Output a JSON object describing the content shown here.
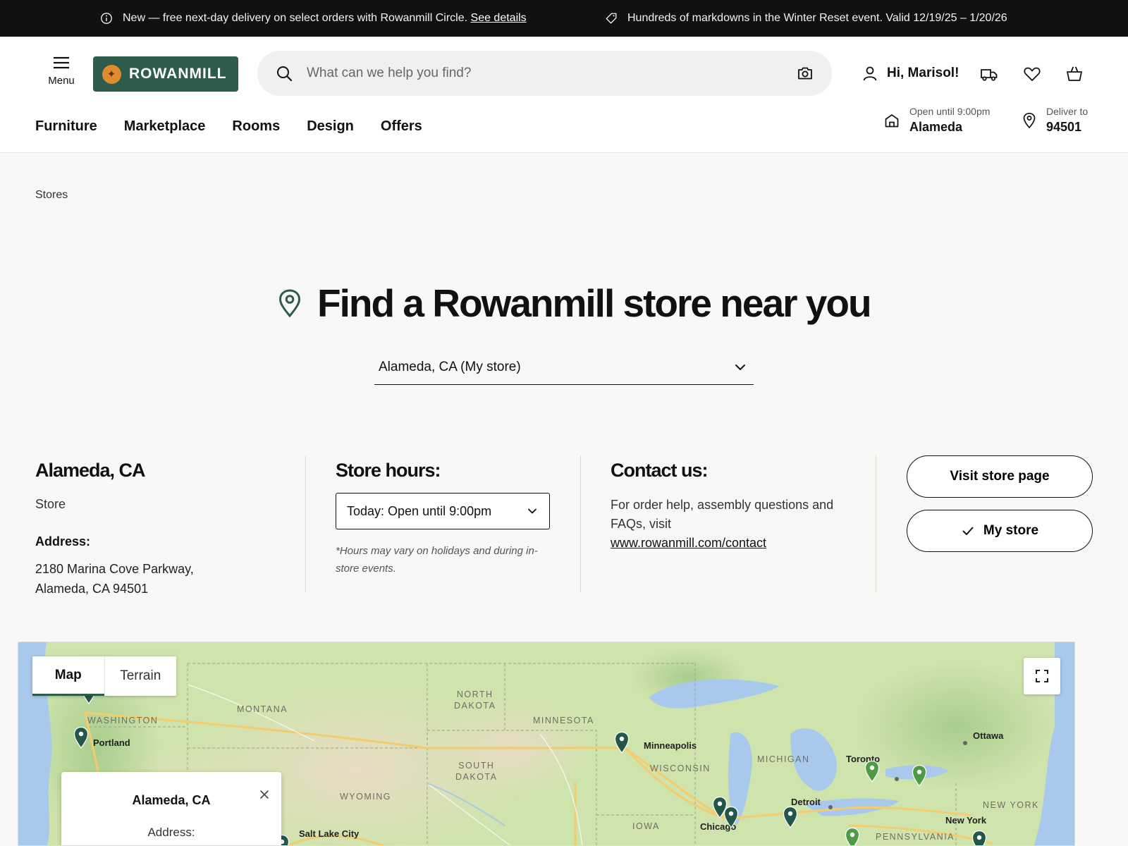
{
  "announcement": {
    "message1": "New — free next-day delivery on select orders with Rowanmill Circle.",
    "message1_link": "See details",
    "message2": "Hundreds of markdowns in the Winter Reset event. Valid 12/19/25 – 1/20/26"
  },
  "header": {
    "menu_label": "Menu",
    "logo_text": "ROWANMILL",
    "search_placeholder": "What can we help you find?",
    "greeting": "Hi, Marisol!",
    "nav": [
      "Furniture",
      "Marketplace",
      "Rooms",
      "Design",
      "Offers"
    ],
    "store_status": "Open until 9:00pm",
    "store_name": "Alameda",
    "deliver_label": "Deliver to",
    "deliver_zip": "94501"
  },
  "breadcrumb": "Stores",
  "hero": {
    "title": "Find a Rowanmill store near you",
    "selected_store": "Alameda, CA (My store)"
  },
  "store": {
    "name": "Alameda, CA",
    "type": "Store",
    "address_label": "Address:",
    "address_line1": "2180 Marina Cove Parkway,",
    "address_line2": "Alameda, CA 94501",
    "hours_title": "Store hours:",
    "hours_today": "Today: Open until 9:00pm",
    "hours_note": "*Hours may vary on holidays and during in-store events.",
    "contact_title": "Contact us:",
    "contact_text": "For order help, assembly questions and FAQs, visit",
    "contact_link": "www.rowanmill.com/contact",
    "visit_button": "Visit store page",
    "mystore_button": "My store"
  },
  "map": {
    "tab_map": "Map",
    "tab_terrain": "Terrain",
    "popup_title": "Alameda, CA",
    "popup_address_label": "Address:",
    "regions": [
      "WASHINGTON",
      "MONTANA",
      "NORTH\nDAKOTA",
      "MINNESOTA",
      "SOUTH\nDAKOTA",
      "WYOMING",
      "WISCONSIN",
      "MICHIGAN",
      "IOWA",
      "NEW YORK",
      "PENNSYLVANIA"
    ],
    "cities": [
      "Portland",
      "Minneapolis",
      "Ottawa",
      "Toronto",
      "Detroit",
      "Chicago",
      "New York",
      "Salt Lake City"
    ]
  },
  "colors": {
    "brand_green": "#2e5b4a",
    "logo_badge": "#e08b2d",
    "pin_dark": "#24574a",
    "pin_light": "#4f9a45"
  }
}
